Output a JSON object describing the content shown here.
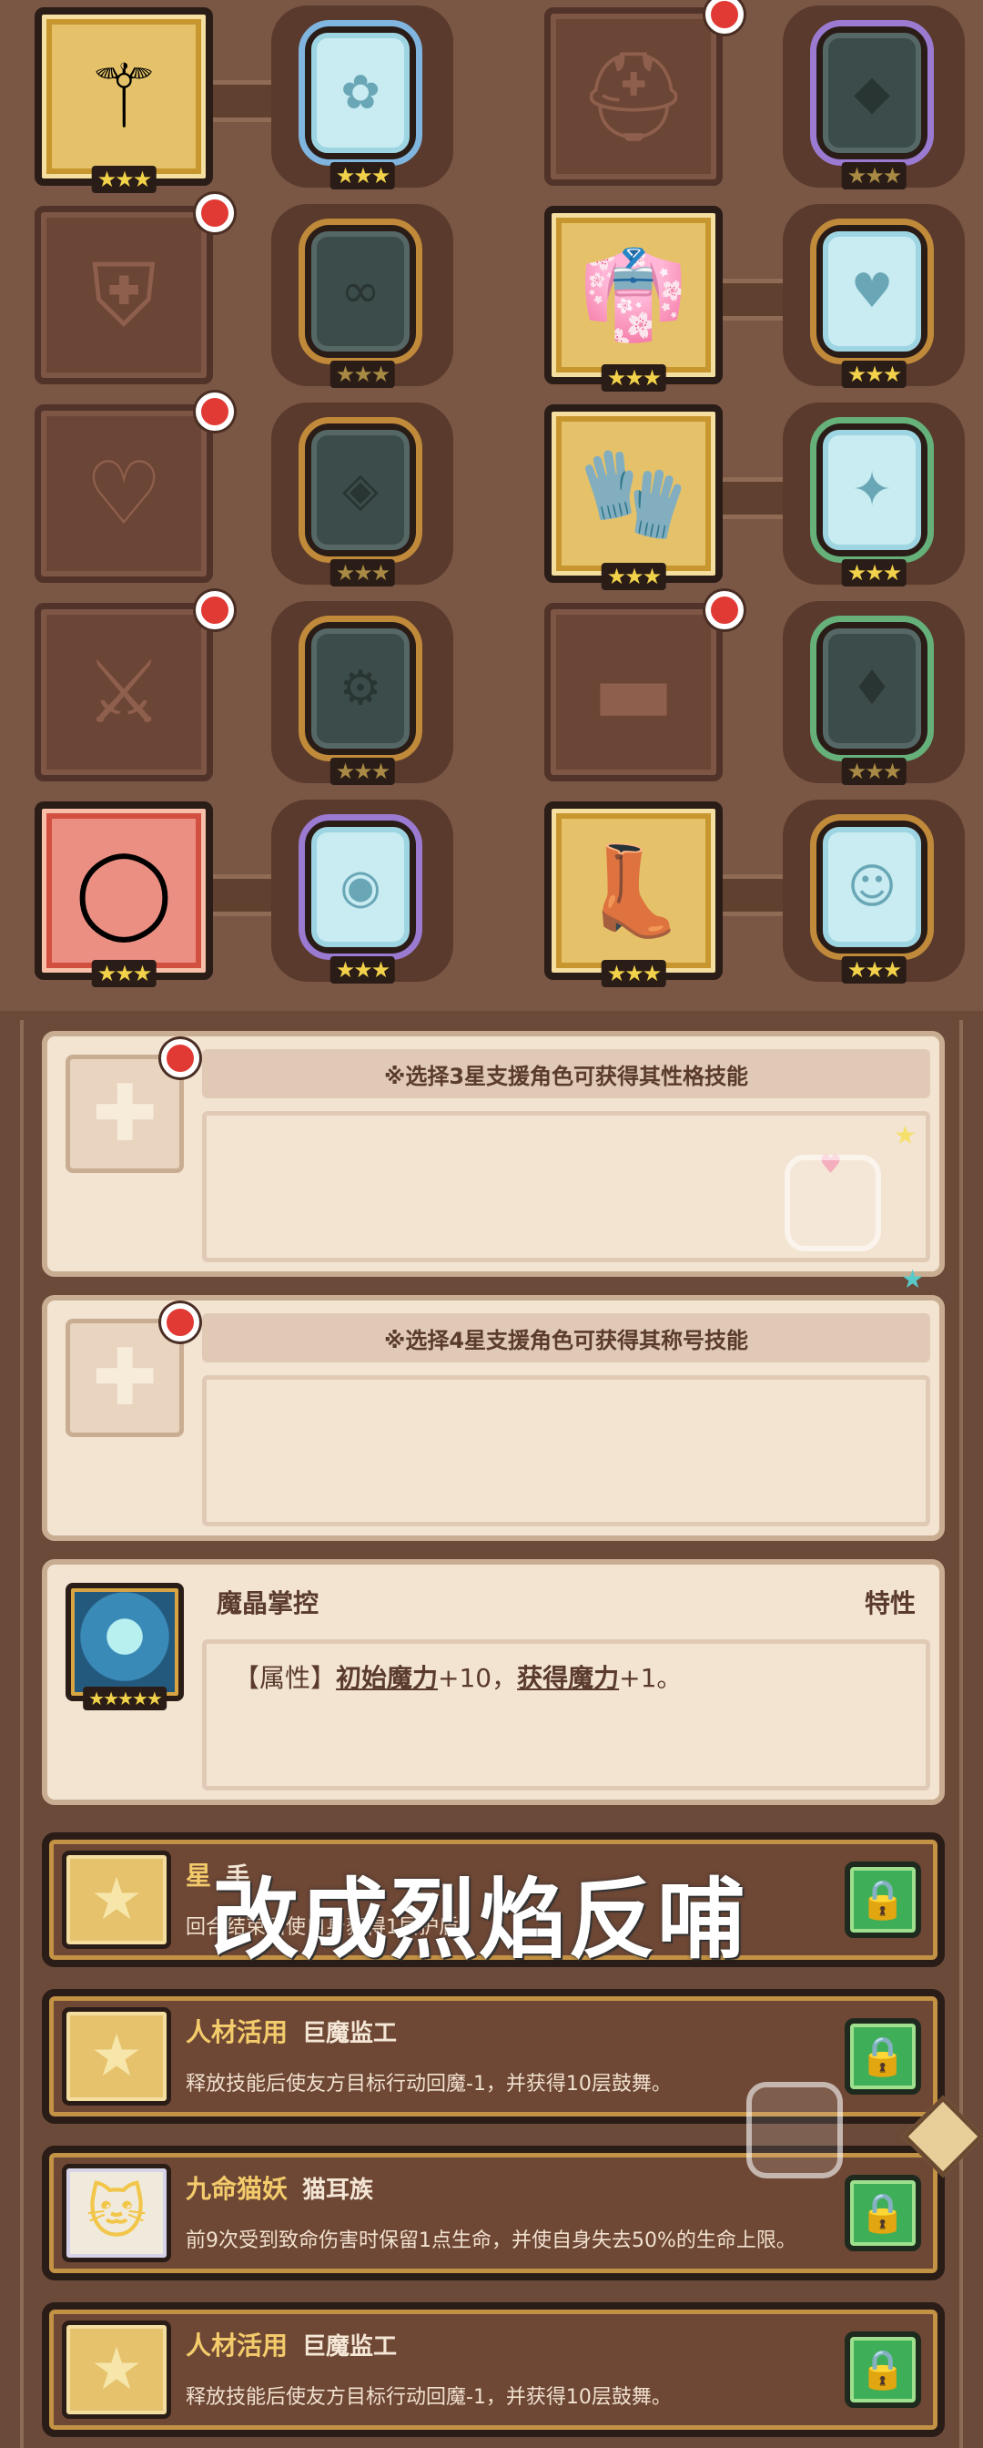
{
  "equipment_rows": [
    {
      "left": {
        "state": "filled",
        "icon": "mace-icon",
        "glyph": "⚚",
        "stars": "★★★",
        "red_dot": false,
        "linked": true,
        "gem": {
          "type": "ice",
          "ring": "blue",
          "glyph": "✿",
          "stars": "★★★"
        }
      },
      "right": {
        "state": "empty",
        "icon": "helmet-icon",
        "glyph": "⛑",
        "stars": "",
        "red_dot": true,
        "linked": false,
        "gem": {
          "type": "dark",
          "ring": "purple",
          "glyph": "◆",
          "stars": "★★★"
        }
      }
    },
    {
      "left": {
        "state": "empty",
        "icon": "shield-icon",
        "glyph": "⛨",
        "stars": "",
        "red_dot": true,
        "linked": false,
        "gem": {
          "type": "dark",
          "ring": "bronze",
          "glyph": "∞",
          "stars": "★★★"
        }
      },
      "right": {
        "state": "filled",
        "icon": "robe-icon",
        "glyph": "👘",
        "stars": "★★★",
        "red_dot": false,
        "linked": true,
        "gem": {
          "type": "ice",
          "ring": "bronze",
          "glyph": "♥",
          "stars": "★★★"
        }
      }
    },
    {
      "left": {
        "state": "empty",
        "icon": "amulet-icon",
        "glyph": "♡",
        "stars": "",
        "red_dot": true,
        "linked": false,
        "gem": {
          "type": "dark",
          "ring": "bronze",
          "glyph": "◈",
          "stars": "★★★"
        }
      },
      "right": {
        "state": "filled",
        "icon": "gauntlet-icon",
        "glyph": "🧤",
        "stars": "★★★",
        "red_dot": false,
        "linked": true,
        "gem": {
          "type": "ice",
          "ring": "green",
          "glyph": "✦",
          "stars": "★★★"
        }
      }
    },
    {
      "left": {
        "state": "empty",
        "icon": "sword-emblem-icon",
        "glyph": "⚔",
        "stars": "",
        "red_dot": true,
        "linked": false,
        "gem": {
          "type": "dark",
          "ring": "bronze",
          "glyph": "⚙",
          "stars": "★★★"
        }
      },
      "right": {
        "state": "empty",
        "icon": "belt-icon",
        "glyph": "▬",
        "stars": "",
        "red_dot": true,
        "linked": false,
        "gem": {
          "type": "dark",
          "ring": "green",
          "glyph": "♦",
          "stars": "★★★"
        }
      }
    },
    {
      "left": {
        "state": "filled-red",
        "icon": "ring-icon",
        "glyph": "◯",
        "stars": "★★★",
        "red_dot": false,
        "linked": true,
        "gem": {
          "type": "ice",
          "ring": "purple",
          "glyph": "◉",
          "stars": "★★★"
        }
      },
      "right": {
        "state": "filled",
        "icon": "boots-icon",
        "glyph": "👢",
        "stars": "★★★",
        "red_dot": false,
        "linked": true,
        "gem": {
          "type": "ice",
          "ring": "bronze",
          "glyph": "☺",
          "stars": "★★★"
        }
      }
    }
  ],
  "support_slots": [
    {
      "hint": "※选择3星支援角色可获得其性格技能"
    },
    {
      "hint": "※选择4星支援角色可获得其称号技能"
    }
  ],
  "trait_card": {
    "title": "魔晶掌控",
    "badge": "特性",
    "portrait_stars": "★★★★★",
    "desc_prefix": "【属性】",
    "desc_attr1": "初始魔力",
    "desc_mid": "+10，",
    "desc_attr2": "获得魔力",
    "desc_suffix": "+1。"
  },
  "skills": [
    {
      "name": "星",
      "tag": "手",
      "desc": "回合结束后使自身获得1层护盾",
      "icon_glyph": "★",
      "icon_style": "gold"
    },
    {
      "name": "人材活用",
      "tag": "巨魔监工",
      "desc": "释放技能后使友方目标行动回魔-1，并获得10层鼓舞。",
      "icon_glyph": "★",
      "icon_style": "gold"
    },
    {
      "name": "九命猫妖",
      "tag": "猫耳族",
      "desc": "前9次受到致命伤害时保留1点生命，并使自身失去50%的生命上限。",
      "icon_glyph": "🐱",
      "icon_style": "white"
    },
    {
      "name": "人材活用",
      "tag": "巨魔监工",
      "desc": "释放技能后使友方目标行动回魔-1，并获得10层鼓舞。",
      "icon_glyph": "★",
      "icon_style": "gold"
    }
  ],
  "overlay_caption": "改成烈焰反哺",
  "lock_glyph": "🔒"
}
